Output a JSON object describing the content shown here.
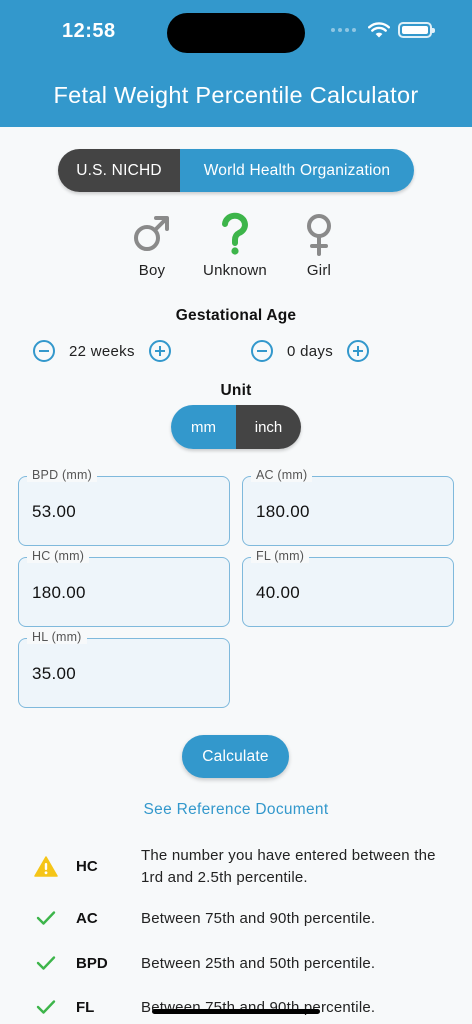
{
  "status_bar": {
    "time": "12:58"
  },
  "header": {
    "title": "Fetal Weight Percentile Calculator"
  },
  "standard_toggle": {
    "options": [
      "U.S. NICHD",
      "World Health Organization"
    ],
    "selected": "World Health Organization"
  },
  "gender": {
    "options": [
      {
        "label": "Boy",
        "icon": "male-symbol-icon",
        "color": "#8a8a8a"
      },
      {
        "label": "Unknown",
        "icon": "question-mark-icon",
        "color": "#3db54a"
      },
      {
        "label": "Girl",
        "icon": "female-symbol-icon",
        "color": "#8a8a8a"
      }
    ],
    "selected": "Unknown"
  },
  "gestational_age": {
    "label": "Gestational Age",
    "weeks": "22 weeks",
    "days": "0 days"
  },
  "unit": {
    "label": "Unit",
    "options": [
      "mm",
      "inch"
    ],
    "selected": "mm"
  },
  "fields": {
    "bpd": {
      "label": "BPD (mm)",
      "value": "53.00"
    },
    "ac": {
      "label": "AC (mm)",
      "value": "180.00"
    },
    "hc": {
      "label": "HC (mm)",
      "value": "180.00"
    },
    "fl": {
      "label": "FL (mm)",
      "value": "40.00"
    },
    "hl": {
      "label": "HL (mm)",
      "value": "35.00"
    }
  },
  "calculate_label": "Calculate",
  "reference_link": "See Reference Document",
  "results": [
    {
      "code": "HC",
      "status": "warning",
      "text": "The number you have entered between the 1rd and 2.5th percentile."
    },
    {
      "code": "AC",
      "status": "ok",
      "text": "Between 75th and 90th percentile."
    },
    {
      "code": "BPD",
      "status": "ok",
      "text": "Between 25th and 50th percentile."
    },
    {
      "code": "FL",
      "status": "ok",
      "text": "Between 75th and 90th percentile."
    }
  ],
  "colors": {
    "primary": "#3398cc",
    "dark": "#444444",
    "success": "#3db54a",
    "warning": "#f5c518"
  }
}
